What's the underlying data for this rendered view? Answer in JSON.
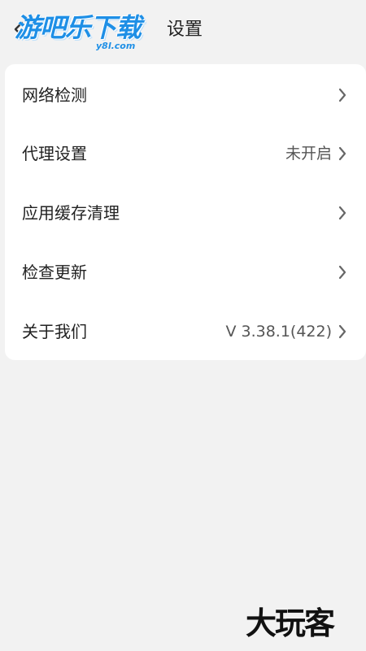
{
  "header": {
    "title": "设置",
    "logo_main": "游吧乐下载",
    "logo_sub": "y8l.com"
  },
  "settings": {
    "items": [
      {
        "label": "网络检测",
        "value": ""
      },
      {
        "label": "代理设置",
        "value": "未开启"
      },
      {
        "label": "应用缓存清理",
        "value": ""
      },
      {
        "label": "检查更新",
        "value": ""
      },
      {
        "label": "关于我们",
        "value": "V 3.38.1(422)"
      }
    ]
  },
  "watermark": {
    "text": "大玩客"
  },
  "icons": {
    "back": "back-arrow-icon",
    "chevron": "chevron-right-icon"
  },
  "colors": {
    "background": "#f2f2f2",
    "card": "#ffffff",
    "logo_blue": "#1e8fe6",
    "text": "#222222",
    "chevron": "#666666"
  }
}
